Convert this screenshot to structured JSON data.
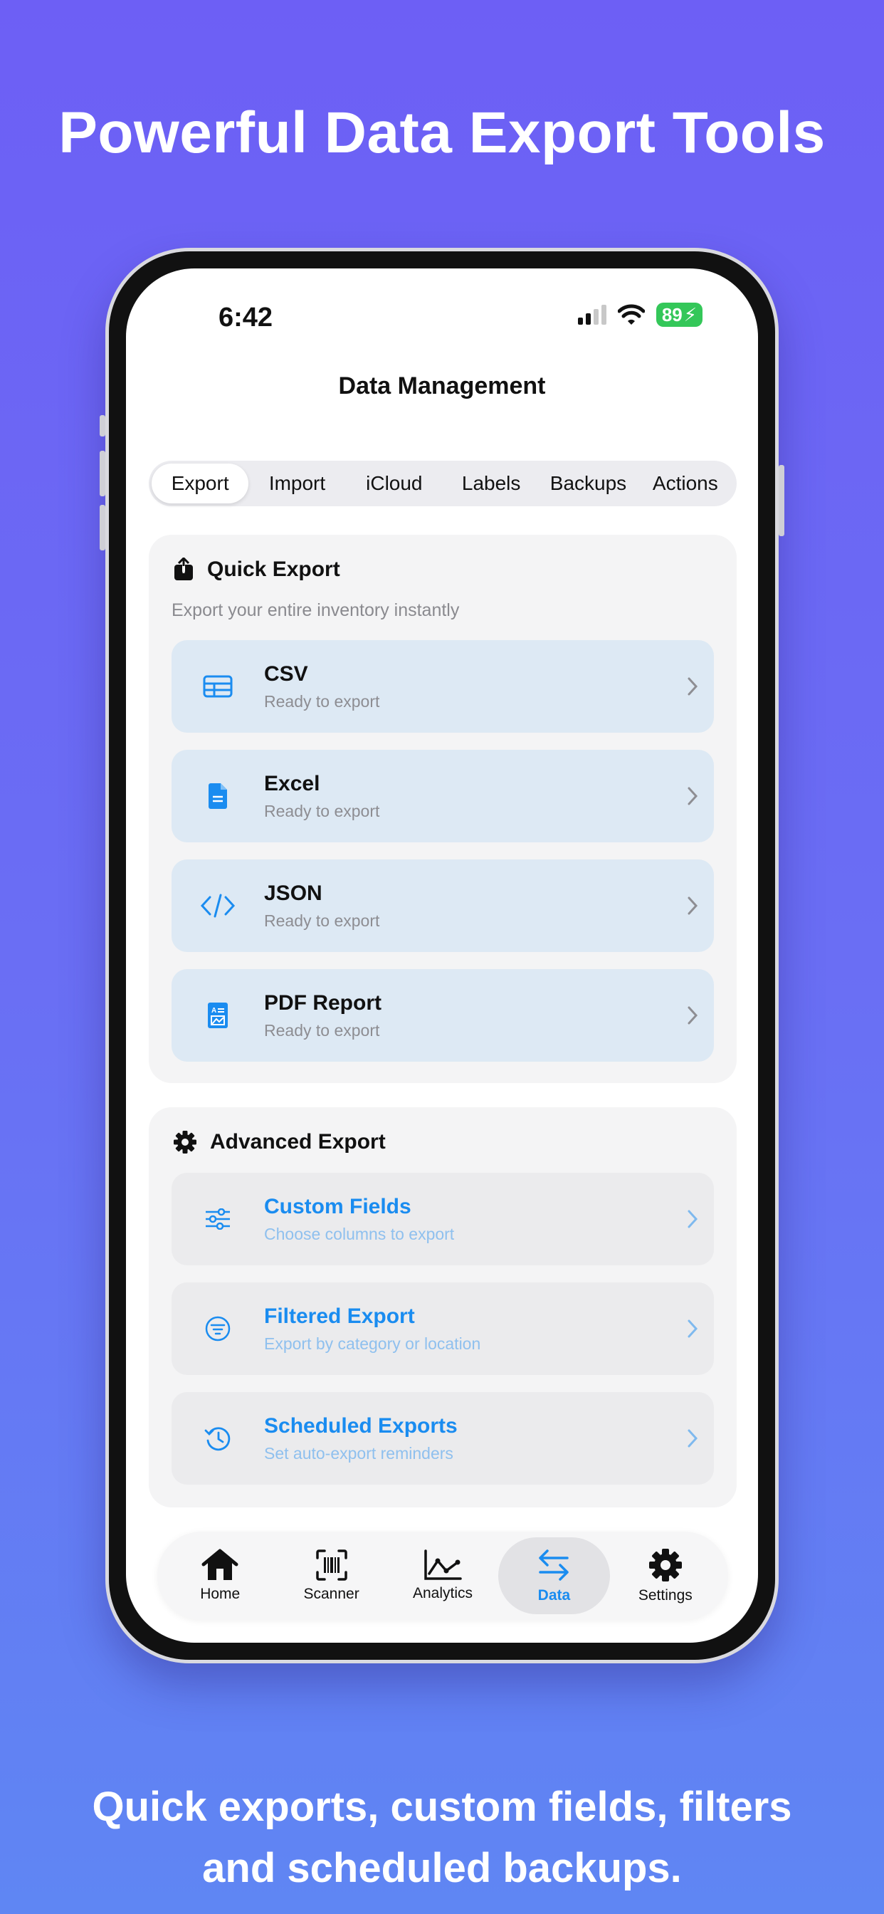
{
  "marketing": {
    "headline": "Powerful Data Export Tools",
    "subline_1": "Quick exports, custom fields, filters",
    "subline_2": "and scheduled backups."
  },
  "status_bar": {
    "time": "6:42",
    "battery": "89"
  },
  "nav": {
    "title": "Data Management"
  },
  "segments": [
    "Export",
    "Import",
    "iCloud",
    "Labels",
    "Backups",
    "Actions"
  ],
  "selected_segment": "Export",
  "quick_export": {
    "title": "Quick Export",
    "subtitle": "Export your entire inventory instantly",
    "items": [
      {
        "title": "CSV",
        "status": "Ready to export",
        "icon": "table-icon"
      },
      {
        "title": "Excel",
        "status": "Ready to export",
        "icon": "document-icon"
      },
      {
        "title": "JSON",
        "status": "Ready to export",
        "icon": "code-icon"
      },
      {
        "title": "PDF Report",
        "status": "Ready to export",
        "icon": "report-icon"
      }
    ]
  },
  "advanced_export": {
    "title": "Advanced Export",
    "items": [
      {
        "title": "Custom Fields",
        "subtitle": "Choose columns to export",
        "icon": "sliders-icon"
      },
      {
        "title": "Filtered Export",
        "subtitle": "Export by category or location",
        "icon": "filter-icon"
      },
      {
        "title": "Scheduled Exports",
        "subtitle": "Set auto-export reminders",
        "icon": "clock-history-icon"
      }
    ]
  },
  "tab_bar": {
    "items": [
      {
        "label": "Home",
        "icon": "house-icon"
      },
      {
        "label": "Scanner",
        "icon": "barcode-scan-icon"
      },
      {
        "label": "Analytics",
        "icon": "chart-line-icon"
      },
      {
        "label": "Data",
        "icon": "arrows-exchange-icon"
      },
      {
        "label": "Settings",
        "icon": "gear-icon"
      }
    ],
    "active": "Data"
  },
  "colors": {
    "accent": "#1a8cf0",
    "battery": "#34c759",
    "background_top": "#6d5ff5",
    "background_bottom": "#5f86f3"
  }
}
